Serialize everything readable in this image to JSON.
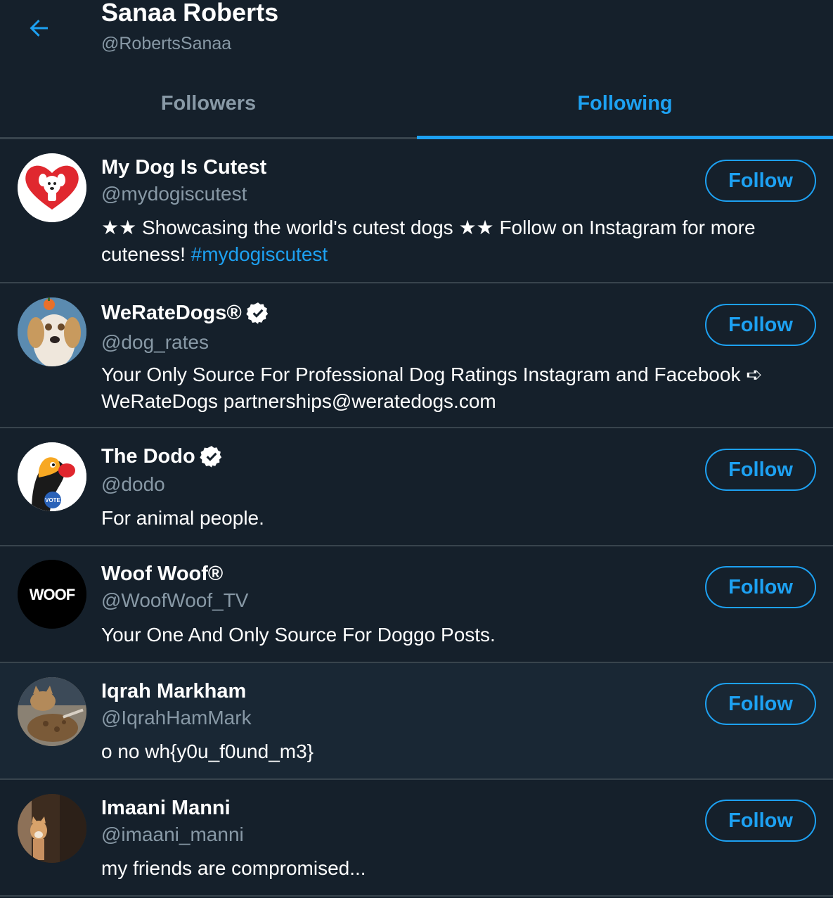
{
  "header": {
    "name": "Sanaa Roberts",
    "handle": "@RobertsSanaa",
    "back_icon": "arrow-left-icon"
  },
  "tabs": [
    {
      "label": "Followers",
      "active": false
    },
    {
      "label": "Following",
      "active": true
    }
  ],
  "colors": {
    "background": "#15202b",
    "accent": "#1da1f2",
    "secondary_text": "#8899a6",
    "divider": "#38444d"
  },
  "accounts": [
    {
      "name": "My Dog Is Cutest",
      "handle": "@mydogiscutest",
      "verified": false,
      "bio": "★★ Showcasing the world's cutest dogs ★★ Follow on Instagram for more cuteness! ",
      "bio_hashtag": "#mydogiscutest",
      "button": "Follow"
    },
    {
      "name": "WeRateDogs®",
      "handle": "@dog_rates",
      "verified": true,
      "bio": "Your Only Source For Professional Dog Ratings Instagram and Facebook ➪ WeRateDogs partnerships@weratedogs.com",
      "button": "Follow"
    },
    {
      "name": "The Dodo",
      "handle": "@dodo",
      "verified": true,
      "bio": "For animal people.",
      "avatar_badge_text": "VOTE",
      "button": "Follow"
    },
    {
      "name": "Woof Woof®",
      "handle": "@WoofWoof_TV",
      "verified": false,
      "bio": "Your One And Only Source For Doggo Posts.",
      "avatar_text": "WOOF",
      "button": "Follow"
    },
    {
      "name": "Iqrah Markham",
      "handle": "@IqrahHamMark",
      "verified": false,
      "bio": "o no wh{y0u_f0und_m3}",
      "button": "Follow"
    },
    {
      "name": "Imaani Manni",
      "handle": "@imaani_manni",
      "verified": false,
      "bio": "my friends are compromised...",
      "button": "Follow"
    }
  ]
}
